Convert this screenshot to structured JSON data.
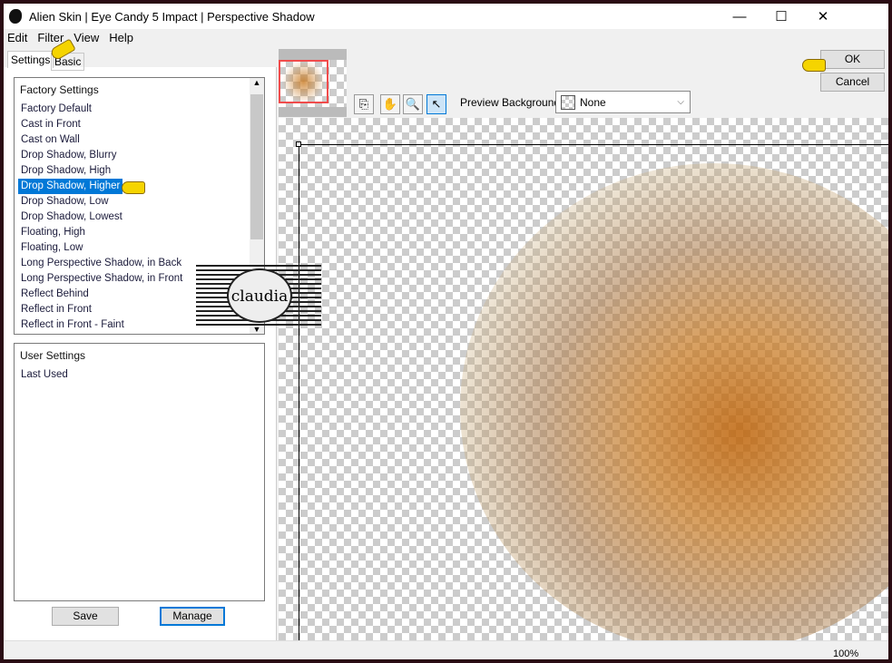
{
  "window": {
    "title": "Alien Skin | Eye Candy 5 Impact | Perspective Shadow",
    "minimize": "—",
    "maximize": "☐",
    "close": "✕"
  },
  "menu": [
    "Edit",
    "Filter",
    "View",
    "Help"
  ],
  "tabs": [
    "Settings",
    "Basic"
  ],
  "factory": {
    "header": "Factory Settings",
    "items": [
      "Factory Default",
      "Cast in Front",
      "Cast on Wall",
      "Drop Shadow, Blurry",
      "Drop Shadow, High",
      "Drop Shadow, Higher",
      "Drop Shadow, Low",
      "Drop Shadow, Lowest",
      "Floating, High",
      "Floating, Low",
      "Long Perspective Shadow, in Back",
      "Long Perspective Shadow, in Front",
      "Reflect Behind",
      "Reflect in Front",
      "Reflect in Front - Faint"
    ],
    "selected": "Drop Shadow, Higher"
  },
  "user": {
    "header": "User Settings",
    "items": [
      "Last Used"
    ]
  },
  "buttons": {
    "save": "Save",
    "manage": "Manage",
    "ok": "OK",
    "cancel": "Cancel"
  },
  "toolbar": {
    "tools": [
      "zoom-preview",
      "hand",
      "zoom",
      "pointer"
    ],
    "active": "pointer",
    "preview_bg_label": "Preview Background:",
    "preview_bg_value": "None"
  },
  "status": {
    "zoom": "100%"
  },
  "watermark": "claudia",
  "colors": {
    "selection": "#0078d7",
    "thumb_frame": "#f04c4c"
  }
}
